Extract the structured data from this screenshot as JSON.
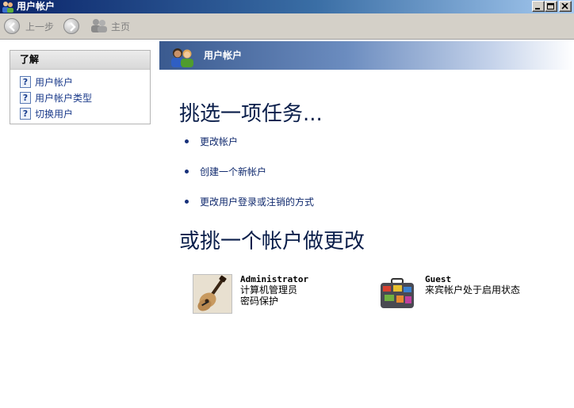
{
  "window": {
    "title": "用户帐户"
  },
  "toolbar": {
    "back_label": "上一步",
    "home_label": "主页"
  },
  "sidebar": {
    "header": "了解",
    "items": [
      {
        "label": "用户帐户"
      },
      {
        "label": "用户帐户类型"
      },
      {
        "label": "切换用户"
      }
    ]
  },
  "band": {
    "title": "用户帐户"
  },
  "main": {
    "task_heading": "挑选一项任务...",
    "tasks": [
      {
        "label": "更改帐户"
      },
      {
        "label": "创建一个新帐户"
      },
      {
        "label": "更改用户登录或注销的方式"
      }
    ],
    "pick_heading": "或挑一个帐户做更改"
  },
  "accounts": [
    {
      "name": "Administrator",
      "lines": [
        "计算机管理员",
        "密码保护"
      ],
      "picture": "guitar-picture"
    },
    {
      "name": "Guest",
      "lines": [
        "来宾帐户处于启用状态"
      ],
      "picture": "suitcase-picture"
    }
  ],
  "colors": {
    "titlebar_start": "#0a246a",
    "titlebar_end": "#a6caf0",
    "chrome": "#d4d0c8",
    "link": "#1a3a8a",
    "heading": "#0a1e4a",
    "band_start": "#3a5a8f"
  },
  "icons": {
    "title": "user-accounts-icon",
    "back": "arrow-left-icon",
    "forward": "arrow-right-icon",
    "home": "home-users-icon",
    "help": "help-question-icon"
  }
}
